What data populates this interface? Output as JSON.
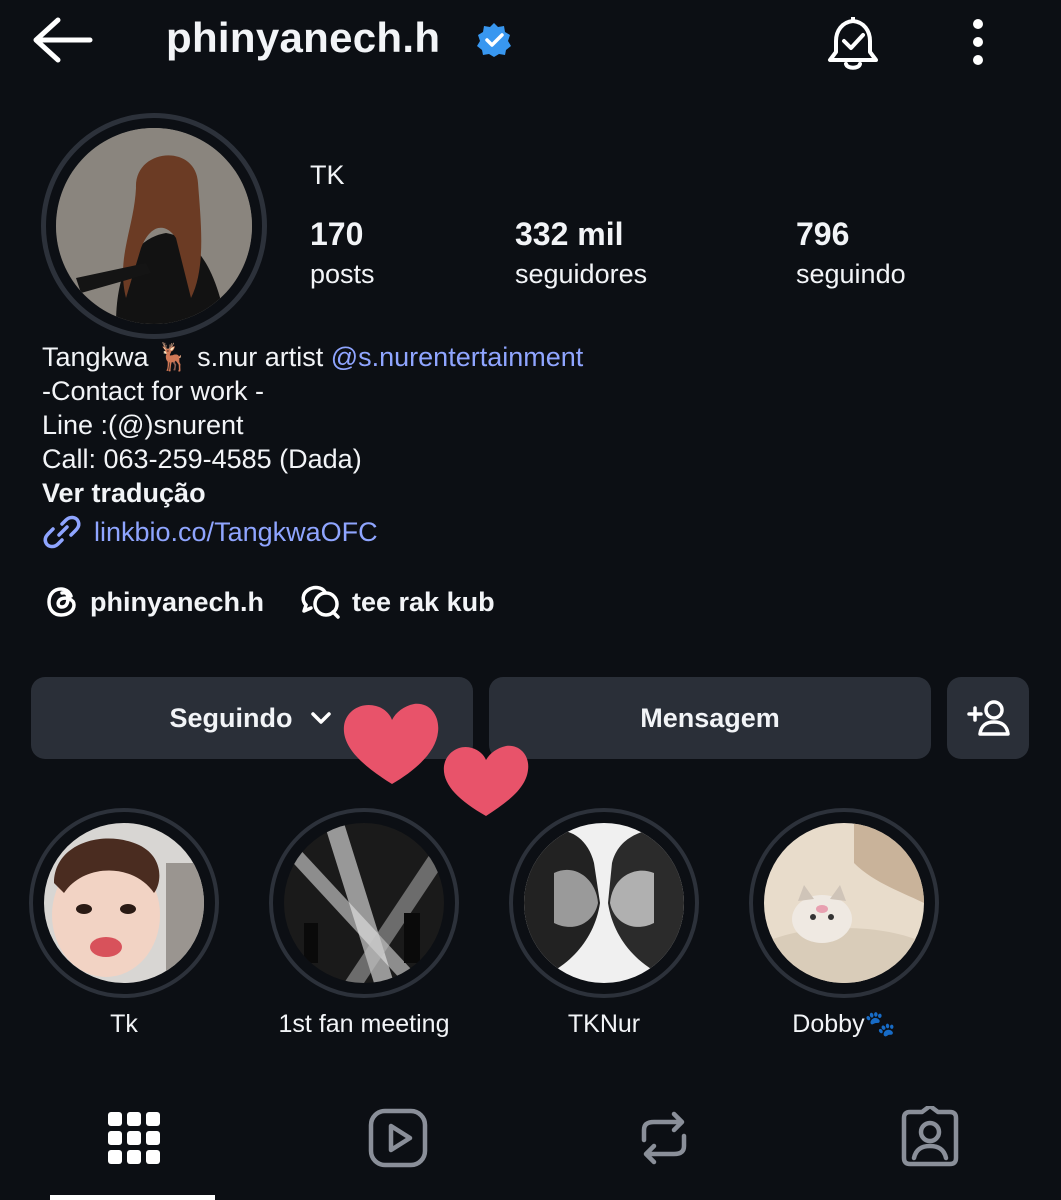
{
  "header": {
    "username": "phinyanech.h",
    "back_icon": "arrow-left-icon",
    "verified_icon": "verified-badge-icon",
    "notification_icon": "bell-check-icon",
    "more_icon": "more-vertical-icon"
  },
  "profile": {
    "display_name": "TK",
    "stats": [
      {
        "value": "170",
        "label": "posts"
      },
      {
        "value": "332 mil",
        "label": "seguidores"
      },
      {
        "value": "796",
        "label": "seguindo"
      }
    ]
  },
  "bio": {
    "line1_prefix": "Tangkwa 🦌 s.nur artist ",
    "line1_mention": "@s.nurentertainment",
    "line2": "-Contact for work -",
    "line3": "Line :(@)snurent",
    "line4": "Call: 063-259-4585 (Dada)",
    "translate": "Ver tradução",
    "link": "linkbio.co/TangkwaOFC"
  },
  "chips": {
    "threads": "phinyanech.h",
    "chat": "tee rak kub"
  },
  "actions": {
    "following": "Seguindo",
    "message": "Mensagem"
  },
  "highlights": [
    {
      "label": "Tk"
    },
    {
      "label": "1st fan meeting"
    },
    {
      "label": "TKNur"
    },
    {
      "label": "Dobby🐾"
    }
  ],
  "colors": {
    "background": "#0c0f14",
    "button": "#2a2f38",
    "link": "#8fa5ff",
    "verified": "#3897f0",
    "heart": "#e8536a"
  }
}
